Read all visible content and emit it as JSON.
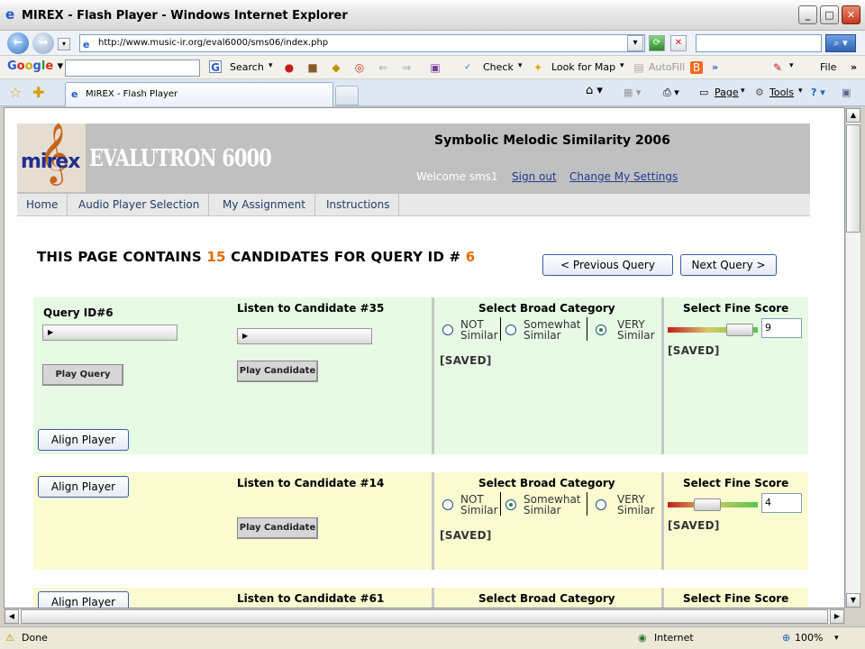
{
  "window": {
    "title": "MIREX - Flash Player - Windows Internet Explorer"
  },
  "address": {
    "url": "http://www.music-ir.org/eval6000/sms06/index.php"
  },
  "googlebar": {
    "search_label": "Search",
    "check_label": "Check",
    "lookformap_label": "Look for Map",
    "autofill_label": "AutoFill",
    "file_label": "File"
  },
  "tabs": [
    {
      "label": "MIREX - Flash Player"
    }
  ],
  "commandbar": {
    "page_label": "Page",
    "tools_label": "Tools"
  },
  "header": {
    "brand": "EVALUTRON 6000",
    "logo_text": "mirex",
    "title": "Symbolic Melodic Similarity 2006",
    "welcome": "Welcome sms1",
    "signout": "Sign out",
    "settings": "Change My Settings"
  },
  "nav": [
    {
      "label": "Home"
    },
    {
      "label": "Audio Player Selection"
    },
    {
      "label": "My Assignment"
    },
    {
      "label": "Instructions"
    }
  ],
  "page": {
    "heading_pre": "THIS PAGE CONTAINS",
    "candidate_count": "15",
    "heading_mid": "CANDIDATES FOR QUERY ID #",
    "query_id": "6",
    "prev_button": "< Previous Query",
    "next_button": "Next Query >"
  },
  "query": {
    "label": "Query ID#6",
    "play_label": "Play Query"
  },
  "align_label": "Align Player",
  "category_header": "Select Broad Category",
  "fine_header": "Select Fine Score",
  "options": {
    "not": [
      "NOT",
      "Similar"
    ],
    "somewhat": [
      "Somewhat",
      "Similar"
    ],
    "very": [
      "VERY",
      "Similar"
    ]
  },
  "candidates": [
    {
      "label": "Listen to Candidate #35",
      "play_label": "Play Candidate",
      "category": "VERY Similar",
      "score": "9",
      "saved": "[SAVED]",
      "fine_saved": "[SAVED]"
    },
    {
      "label": "Listen to Candidate #14",
      "play_label": "Play Candidate",
      "category": "Somewhat Similar",
      "score": "4",
      "saved": "[SAVED]",
      "fine_saved": "[SAVED]"
    },
    {
      "label": "Listen to Candidate #61"
    }
  ],
  "scrollbars": {
    "h_arrow_left": "◀",
    "h_arrow_right": "▶"
  },
  "status": {
    "left": "Done",
    "zone": "Internet",
    "zoom": "100%"
  },
  "colors": {
    "accent_orange": "#e06c00",
    "row_green": "#e6fae4",
    "row_yellow": "#fbfbd1"
  }
}
